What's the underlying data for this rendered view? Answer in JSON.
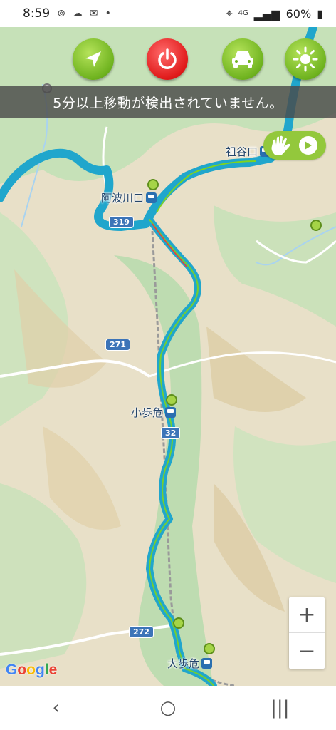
{
  "status": {
    "time": "8:59",
    "network": "4G",
    "battery": "60%",
    "dot": "•"
  },
  "top_buttons": [
    {
      "icon": "compass-arrow-icon",
      "color": "#7cc327"
    },
    {
      "icon": "power-icon",
      "color": "#e01a1a"
    },
    {
      "icon": "car-icon",
      "color": "#7cc327"
    },
    {
      "icon": "sun-icon",
      "color": "#7cc327"
    }
  ],
  "banner": {
    "text": "5分以上移動が検出されていません。"
  },
  "stations": {
    "iyaguchi": "祖谷口",
    "awakawaguchi": "阿波川口",
    "koboke": "小歩危",
    "oboke": "大歩危"
  },
  "roads": {
    "r319": "319",
    "r271": "271",
    "r32": "32",
    "r272": "272"
  },
  "map": {
    "logo": "Google",
    "zoom_in": "+",
    "zoom_out": "−"
  },
  "navbar": {
    "back": "‹",
    "home": "○",
    "recents": "|||"
  },
  "colors": {
    "route": "#1fa9c9",
    "accent_green": "#7cc327",
    "banner_bg": "#4b4b4b"
  }
}
